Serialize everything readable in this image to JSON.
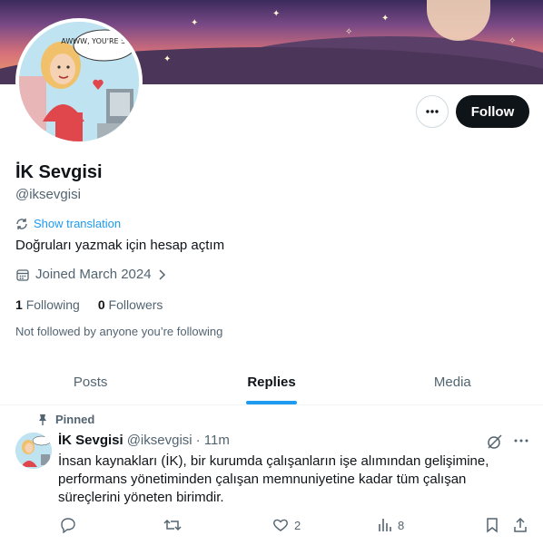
{
  "profile": {
    "name": "İK Sevgisi",
    "handle": "@iksevgisi",
    "show_translation": "Show translation",
    "bio": "Doğruları yazmak için hesap açtım",
    "joined": "Joined March 2024",
    "following_count": "1",
    "following_label": "Following",
    "followers_count": "0",
    "followers_label": "Followers",
    "not_followed": "Not followed by anyone you’re following",
    "avatar_bubble": "AWWW, YOU'RE SWEET."
  },
  "header": {
    "follow_label": "Follow"
  },
  "tabs": [
    {
      "label": "Posts"
    },
    {
      "label": "Replies"
    },
    {
      "label": "Media"
    }
  ],
  "active_tab": "Replies",
  "post": {
    "pinned_label": "Pinned",
    "name": "İK Sevgisi",
    "handle": "@iksevgisi",
    "time": "· 11m",
    "text": "İnsan kaynakları (İK), bir kurumda çalışanların işe alımından gelişimine, performans yönetiminden çalışan memnuniyetine kadar tüm çalışan süreçlerini yöneten birimdir.",
    "likes": "2",
    "views": "8"
  },
  "colors": {
    "accent": "#1d9bf0",
    "text": "#0f1419",
    "muted": "#536471"
  }
}
